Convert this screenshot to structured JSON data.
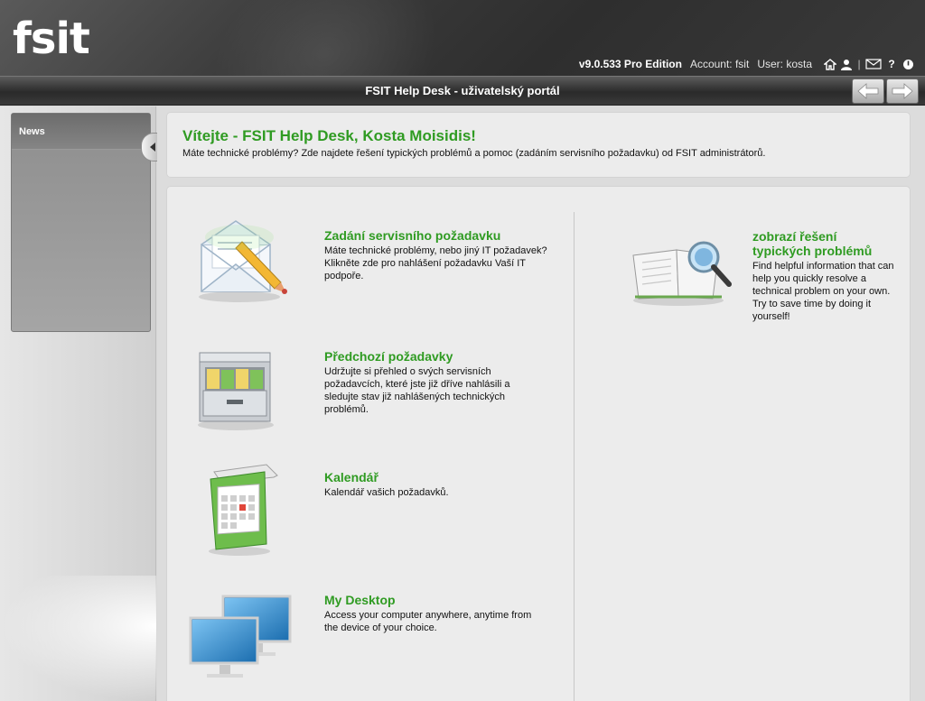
{
  "header": {
    "logo": "fsit",
    "version": "v9.0.533 Pro Edition",
    "account": "Account: fsit",
    "user": "User: kosta",
    "icons": [
      "home-icon",
      "user-icon",
      "mail-icon",
      "help-icon",
      "power-icon"
    ],
    "separator": "|"
  },
  "titlebar": {
    "title": "FSIT Help Desk - uživatelský portál",
    "back_icon": "back-arrow-icon",
    "forward_icon": "forward-arrow-icon"
  },
  "sidebar": {
    "news_label": "News"
  },
  "welcome": {
    "title": "Vítejte - FSIT Help Desk, Kosta Moisidis!",
    "subtitle": "Máte technické problémy? Zde najdete řešení typických problémů a pomoc (zadáním servisního požadavku) od FSIT administrátorů."
  },
  "items": [
    {
      "title": "Zadání servisního požadavku",
      "desc": "Máte technické problémy, nebo jiný IT požadavek? Klikněte zde pro nahlášení požadavku Vaší IT podpoře.",
      "icon": "envelope-pencil-icon"
    },
    {
      "title": "Předchozí požadavky",
      "desc": "Udržujte si přehled o svých servisních požadavcích, které jste již dříve nahlásili a sledujte stav již nahlášených technických problémů.",
      "icon": "file-cabinet-icon"
    },
    {
      "title": "Kalendář",
      "desc": "Kalendář vašich požadavků.",
      "icon": "calendar-icon"
    },
    {
      "title": "My Desktop",
      "desc": "Access your computer anywhere, anytime from the device of your choice.",
      "icon": "monitors-icon"
    },
    {
      "title_line1": "zobrazí řešení",
      "title_line2": "typických problémů",
      "desc": "Find helpful information that can help you quickly resolve a technical problem on your own. Try to save time by doing it yourself!",
      "icon": "book-magnifier-icon"
    }
  ],
  "colors": {
    "accent_green": "#2f9b22",
    "header_dark": "#2e2e2e",
    "logo_blue": "#3aa6d8"
  }
}
